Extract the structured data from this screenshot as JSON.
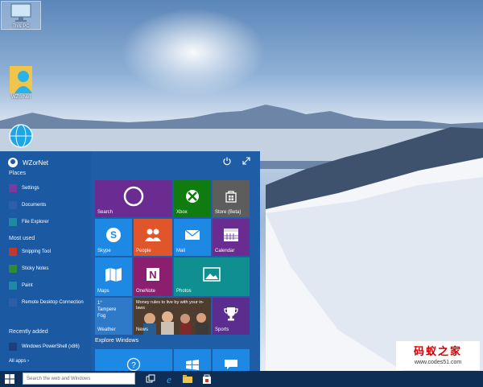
{
  "desktop": {
    "icons": [
      {
        "label": "This PC",
        "icon": "computer-icon"
      },
      {
        "label": "WZorNet",
        "icon": "user-folder-icon"
      },
      {
        "label": "",
        "icon": "network-globe-icon"
      }
    ]
  },
  "start_menu": {
    "user_name": "WZorNet",
    "places_header": "Places",
    "places": [
      {
        "label": "Settings",
        "icon": "settings-icon",
        "color": "#7a3aa0"
      },
      {
        "label": "Documents",
        "icon": "documents-icon",
        "color": "#2d5fa8"
      },
      {
        "label": "File Explorer",
        "icon": "folder-icon",
        "color": "#1f8aa6"
      }
    ],
    "most_used_header": "Most used",
    "most_used": [
      {
        "label": "Snipping Tool",
        "icon": "scissors-icon",
        "color": "#c0392b"
      },
      {
        "label": "Sticky Notes",
        "icon": "sticky-notes-icon",
        "color": "#2e8b3a"
      },
      {
        "label": "Paint",
        "icon": "paint-icon",
        "color": "#1f8aa6"
      },
      {
        "label": "Remote Desktop Connection",
        "icon": "remote-desktop-icon",
        "color": "#2d5fa8"
      }
    ],
    "recently_added_header": "Recently added",
    "recently_added": [
      {
        "label": "Windows PowerShell (x86)",
        "icon": "powershell-icon",
        "color": "#1e3f7a"
      }
    ],
    "all_apps": "All apps ›",
    "power_icon": "power-icon",
    "expand_icon": "expand-icon",
    "tiles": {
      "search": "Search",
      "xbox": "Xbox",
      "store": "Store (Beta)",
      "skype": "Skype",
      "people": "People",
      "mail": "Mail",
      "calendar": "Calendar",
      "maps": "Maps",
      "onenote": "OneNote",
      "photos": "Photos",
      "weather_temp": "1°",
      "weather_city": "Tampere",
      "weather_cond": "Fog",
      "weather": "Weather",
      "news_headline": "Money rules to live by with your in-laws",
      "news": "News",
      "sports": "Sports"
    },
    "explore_header": "Explore Windows"
  },
  "taskbar": {
    "search_placeholder": "Search the web and Windows"
  },
  "watermark": {
    "title": "码蚁之家",
    "url": "www.codes51.com"
  },
  "colors": {
    "start_bg": "#1f5ea7",
    "tile_purple": "#6a2c91",
    "tile_green": "#107c10",
    "tile_gray": "#5d5d5d",
    "tile_blue": "#1e88e5",
    "tile_orange": "#e1552a",
    "tile_teal": "#0f8f8f",
    "tile_red": "#b8124a",
    "tile_violet": "#5b2d8f",
    "taskbar": "#0f2e56"
  }
}
